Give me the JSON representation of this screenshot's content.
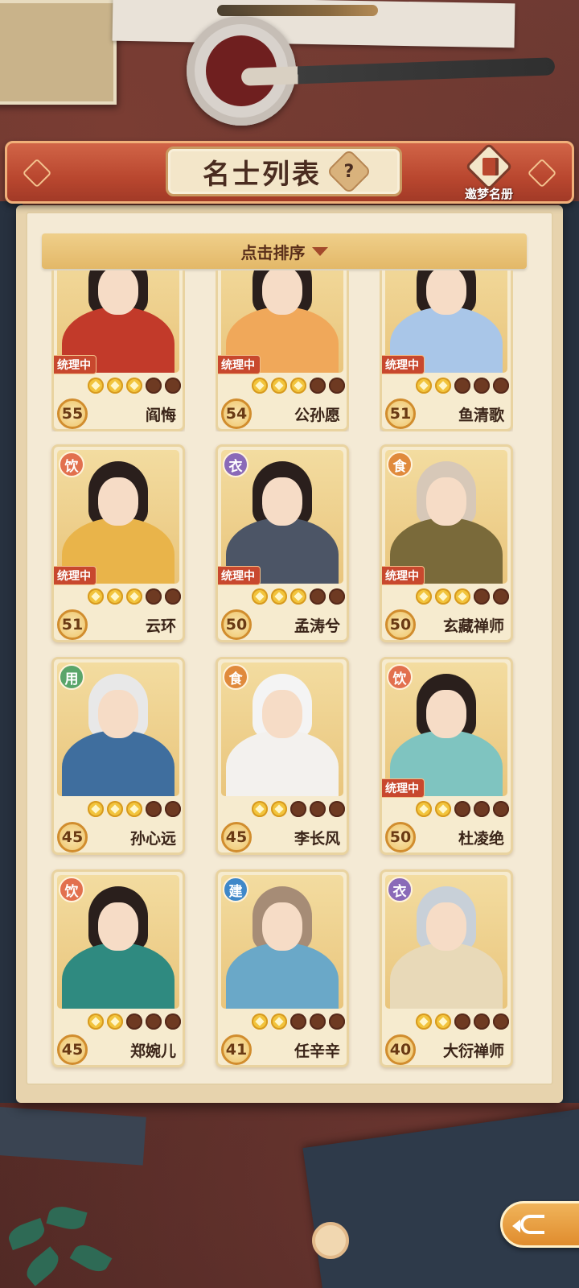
{
  "header": {
    "title": "名士列表",
    "help_label": "?",
    "dream_book_label": "邀梦名册",
    "dream_book_icon": "book-icon"
  },
  "sort": {
    "label": "点击排序",
    "arrow_icon": "triangle-down-icon"
  },
  "status_label": "统理中",
  "category_colors": {
    "饮": "#e2704e",
    "衣": "#8a6ab8",
    "食": "#e08a3c",
    "用": "#5aa56a",
    "建": "#3f88c9"
  },
  "cards": [
    {
      "name": "阎悔",
      "level": "55",
      "category": "",
      "managing": true,
      "stars": 3,
      "max_stars": 5
    },
    {
      "name": "公孙愿",
      "level": "54",
      "category": "",
      "managing": true,
      "stars": 3,
      "max_stars": 5
    },
    {
      "name": "鱼清歌",
      "level": "51",
      "category": "",
      "managing": true,
      "stars": 2,
      "max_stars": 5
    },
    {
      "name": "云环",
      "level": "51",
      "category": "饮",
      "managing": true,
      "stars": 3,
      "max_stars": 5
    },
    {
      "name": "孟涛兮",
      "level": "50",
      "category": "衣",
      "managing": true,
      "stars": 3,
      "max_stars": 5
    },
    {
      "name": "玄藏禅师",
      "level": "50",
      "category": "食",
      "managing": true,
      "stars": 3,
      "max_stars": 5
    },
    {
      "name": "孙心远",
      "level": "45",
      "category": "用",
      "managing": false,
      "stars": 3,
      "max_stars": 5
    },
    {
      "name": "李长风",
      "level": "45",
      "category": "食",
      "managing": false,
      "stars": 2,
      "max_stars": 5
    },
    {
      "name": "杜凌绝",
      "level": "50",
      "category": "饮",
      "managing": true,
      "stars": 2,
      "max_stars": 5
    },
    {
      "name": "郑婉儿",
      "level": "45",
      "category": "饮",
      "managing": false,
      "stars": 2,
      "max_stars": 5
    },
    {
      "name": "任辛辛",
      "level": "41",
      "category": "建",
      "managing": false,
      "stars": 2,
      "max_stars": 5
    },
    {
      "name": "大衍禅师",
      "level": "40",
      "category": "衣",
      "managing": false,
      "stars": 2,
      "max_stars": 5
    }
  ],
  "back_button_icon": "back-arrow-icon"
}
